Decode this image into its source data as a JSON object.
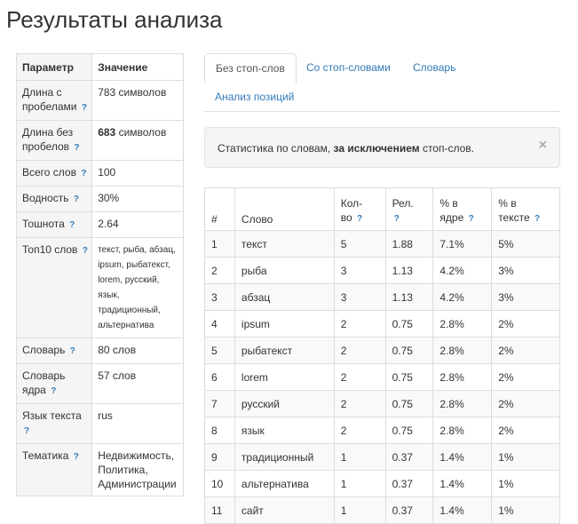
{
  "title": "Результаты анализа",
  "params": {
    "header": {
      "param": "Параметр",
      "value": "Значение"
    },
    "help": "?",
    "rows": [
      {
        "label": "Длина с пробелами",
        "value": "783 символов"
      },
      {
        "label": "Длина без пробелов",
        "value_bold": "683",
        "value_rest": " символов"
      },
      {
        "label": "Всего слов",
        "value": "100"
      },
      {
        "label": "Водность",
        "value": "30%"
      },
      {
        "label": "Тошнота",
        "value": "2.64"
      },
      {
        "label": "Топ10 слов",
        "value": "текст, рыба, абзац, ipsum, рыбатекст, lorem, русский, язык, традиционный, альтернатива"
      },
      {
        "label": "Словарь",
        "value": "80 слов"
      },
      {
        "label": "Словарь ядра",
        "value": "57 слов"
      },
      {
        "label": "Язык текста",
        "value": "rus"
      },
      {
        "label": "Тематика",
        "value": "Недвижимость, Политика, Администрации"
      }
    ]
  },
  "tabs": [
    {
      "label": "Без стоп-слов",
      "active": true
    },
    {
      "label": "Со стоп-словами",
      "active": false
    },
    {
      "label": "Словарь",
      "active": false
    },
    {
      "label": "Анализ позиций",
      "active": false
    }
  ],
  "alert": {
    "text_before": "Статистика по словам, ",
    "text_bold": "за исключением",
    "text_after": " стоп-слов.",
    "close": "×"
  },
  "words": {
    "headers": {
      "num": "#",
      "word": "Слово",
      "count_1": "Кол-",
      "count_2": "во",
      "rel": "Рел.",
      "core_1": "% в",
      "core_2": "ядре",
      "text_1": "% в",
      "text_2": "тексте"
    },
    "rows": [
      {
        "n": "1",
        "word": "текст",
        "count": "5",
        "rel": "1.88",
        "core": "7.1%",
        "text": "5%"
      },
      {
        "n": "2",
        "word": "рыба",
        "count": "3",
        "rel": "1.13",
        "core": "4.2%",
        "text": "3%"
      },
      {
        "n": "3",
        "word": "абзац",
        "count": "3",
        "rel": "1.13",
        "core": "4.2%",
        "text": "3%"
      },
      {
        "n": "4",
        "word": "ipsum",
        "count": "2",
        "rel": "0.75",
        "core": "2.8%",
        "text": "2%"
      },
      {
        "n": "5",
        "word": "рыбатекст",
        "count": "2",
        "rel": "0.75",
        "core": "2.8%",
        "text": "2%"
      },
      {
        "n": "6",
        "word": "lorem",
        "count": "2",
        "rel": "0.75",
        "core": "2.8%",
        "text": "2%"
      },
      {
        "n": "7",
        "word": "русский",
        "count": "2",
        "rel": "0.75",
        "core": "2.8%",
        "text": "2%"
      },
      {
        "n": "8",
        "word": "язык",
        "count": "2",
        "rel": "0.75",
        "core": "2.8%",
        "text": "2%"
      },
      {
        "n": "9",
        "word": "традиционный",
        "count": "1",
        "rel": "0.37",
        "core": "1.4%",
        "text": "1%"
      },
      {
        "n": "10",
        "word": "альтернатива",
        "count": "1",
        "rel": "0.37",
        "core": "1.4%",
        "text": "1%"
      },
      {
        "n": "11",
        "word": "сайт",
        "count": "1",
        "rel": "0.37",
        "core": "1.4%",
        "text": "1%"
      }
    ]
  },
  "colors": {
    "link": "#337ab7",
    "border": "#dddddd",
    "stripe": "#f9f9f9",
    "param_bg": "#f5f5f5"
  }
}
